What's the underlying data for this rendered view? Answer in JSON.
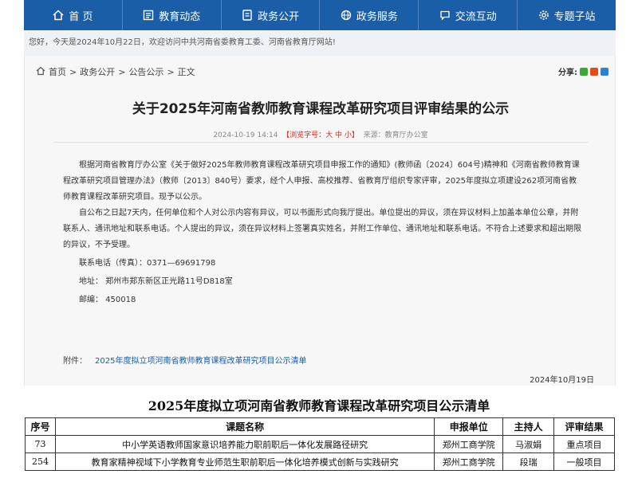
{
  "nav": {
    "items": [
      {
        "label": "首 页",
        "icon": "home-icon"
      },
      {
        "label": "教育动态",
        "icon": "news-icon"
      },
      {
        "label": "政务公开",
        "icon": "document-icon"
      },
      {
        "label": "政务服务",
        "icon": "globe-icon"
      },
      {
        "label": "交流互动",
        "icon": "chat-icon"
      },
      {
        "label": "专题子站",
        "icon": "gear-icon"
      }
    ]
  },
  "welcome": "您好，今天是2024年10月22日，欢迎访问中共河南省委教育工委、河南省教育厅网站!",
  "breadcrumb": {
    "home": "首页",
    "sep": ">",
    "c1": "政务公开",
    "c2": "公告公示",
    "c3": "正文"
  },
  "share_label": "分享:",
  "article": {
    "title": "关于2025年河南省教师教育课程改革研究项目评审结果的公示",
    "date": "2024-10-19 14:14",
    "views_prefix": "【浏览字号：",
    "font_sizes": "大 中 小",
    "views_suffix": "】",
    "source": "来源：教育厅办公室",
    "p1": "根据河南省教育厅办公室《关于做好2025年教师教育课程改革研究项目申报工作的通知》(教师函〔2024〕604号)精神和《河南省教师教育课程改革研究项目管理办法》（教师〔2013〕840号）要求，经个人申报、高校推荐、省教育厅组织专家评审，2025年度拟立项建设262项河南省教师教育课程改革研究项目。现予以公示。",
    "p2": "自公布之日起7天内，任何单位和个人对公示内容有异议，可以书面形式向我厅提出。单位提出的异议，须在异议材料上加盖本单位公章，并附联系人、通讯地址和联系电话。个人提出的异议，须在异议材料上签署真实姓名，并附工作单位、通讯地址和联系电话。不符合上述要求和超出期限的异议，不予受理。",
    "phone": "联系电话（传真）：0371—69691798",
    "address": "地址：  郑州市郑东新区正光路11号D818室",
    "postcode": "邮编：  450018",
    "attachment_label": "附件：",
    "attachment_link": "2025年度拟立项河南省教师教育课程改革研究项目公示清单",
    "sign_date": "2024年10月19日"
  },
  "list": {
    "title": "2025年度拟立项河南省教师教育课程改革研究项目公示清单",
    "headers": [
      "序号",
      "课题名称",
      "申报单位",
      "主持人",
      "评审结果"
    ],
    "rows": [
      [
        "73",
        "中小学英语教师国家意识培养能力职前职后一体化发展路径研究",
        "郑州工商学院",
        "马淑娟",
        "重点项目"
      ],
      [
        "254",
        "教育家精神视域下小学教育专业师范生职前职后一体化培养模式创新与实践研究",
        "郑州工商学院",
        "段瑞",
        "一般项目"
      ]
    ]
  },
  "colors": {
    "nav_bg": "#1a5ea8",
    "welcome_bg": "#eef2f7",
    "panel_bg": "#f7f7f7",
    "link": "#1a5ea8",
    "accent_red": "#d42a20"
  }
}
